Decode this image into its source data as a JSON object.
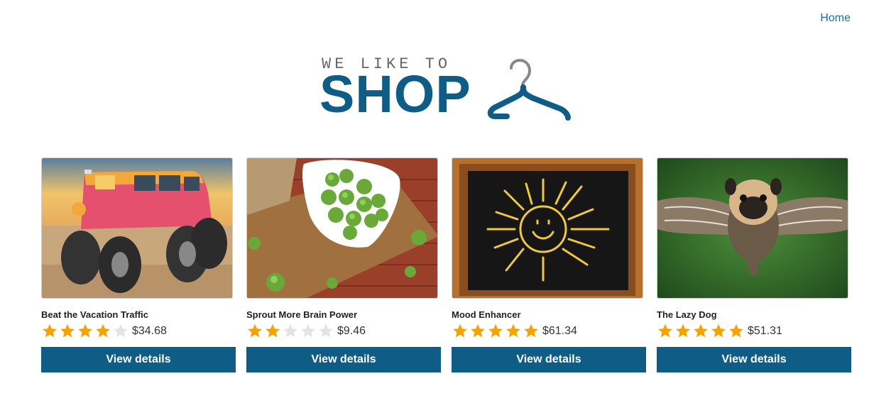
{
  "nav": {
    "home_label": "Home"
  },
  "logo": {
    "tagline": "WE LIKE TO",
    "word": "SHOP",
    "icon": "hanger-icon"
  },
  "colors": {
    "brand": "#0f5d87",
    "star_on": "#f5a300",
    "star_off": "#e0e4e7",
    "link": "#1a6fa8"
  },
  "products": [
    {
      "title": "Beat the Vacation Traffic",
      "rating": 4,
      "price": "$34.68",
      "button": "View details",
      "image": "monster-van-photo"
    },
    {
      "title": "Sprout More Brain Power",
      "rating": 2,
      "price": "$9.46",
      "button": "View details",
      "image": "brussels-sprouts-photo"
    },
    {
      "title": "Mood Enhancer",
      "rating": 5,
      "price": "$61.34",
      "button": "View details",
      "image": "chalkboard-sun-photo"
    },
    {
      "title": "The Lazy Dog",
      "rating": 5,
      "price": "$51.31",
      "button": "View details",
      "image": "flying-pug-photo"
    }
  ]
}
